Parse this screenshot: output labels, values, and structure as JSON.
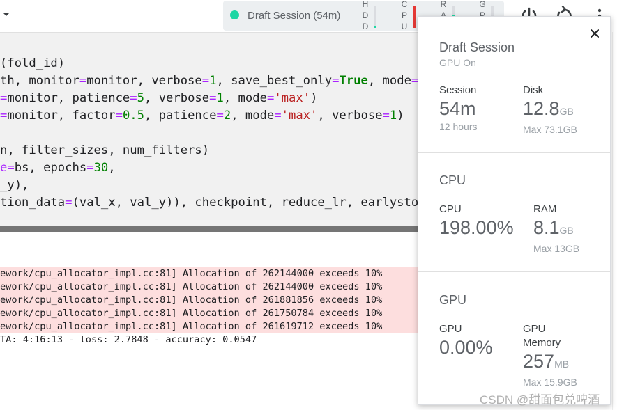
{
  "toolbar": {
    "session_label": "Draft Session (54m)",
    "meters": [
      {
        "label": "HDD",
        "level": 0.1,
        "status_color": "#1ed6a4"
      },
      {
        "label": "CPU",
        "level": 1.0,
        "status_color": "#e53935"
      },
      {
        "label": "RAM",
        "level": 0.6,
        "status_color": "#1ed6a4"
      },
      {
        "label": "GPU",
        "level": 0.0,
        "status_color": "#1ed6a4"
      }
    ],
    "icons": [
      "power-icon",
      "restart-icon",
      "more-vert-icon"
    ]
  },
  "code": {
    "lines": [
      [
        {
          "t": "(fold_id)"
        }
      ],
      [
        {
          "t": "th, monitor"
        },
        {
          "t": "=",
          "c": "op"
        },
        {
          "t": "monitor, verbose"
        },
        {
          "t": "=",
          "c": "op"
        },
        {
          "t": "1",
          "c": "num"
        },
        {
          "t": ", save_best_only"
        },
        {
          "t": "=",
          "c": "op"
        },
        {
          "t": "True",
          "c": "kw"
        },
        {
          "t": ", mode"
        },
        {
          "t": "=",
          "c": "op"
        }
      ],
      [
        {
          "t": "=",
          "c": "op"
        },
        {
          "t": "monitor, patience"
        },
        {
          "t": "=",
          "c": "op"
        },
        {
          "t": "5",
          "c": "num"
        },
        {
          "t": ", verbose"
        },
        {
          "t": "=",
          "c": "op"
        },
        {
          "t": "1",
          "c": "num"
        },
        {
          "t": ", mode"
        },
        {
          "t": "=",
          "c": "op"
        },
        {
          "t": "'max'",
          "c": "str"
        },
        {
          "t": ")"
        }
      ],
      [
        {
          "t": "=",
          "c": "op"
        },
        {
          "t": "monitor, factor"
        },
        {
          "t": "=",
          "c": "op"
        },
        {
          "t": "0.5",
          "c": "num"
        },
        {
          "t": ", patience"
        },
        {
          "t": "=",
          "c": "op"
        },
        {
          "t": "2",
          "c": "num"
        },
        {
          "t": ", mode"
        },
        {
          "t": "=",
          "c": "op"
        },
        {
          "t": "'max'",
          "c": "str"
        },
        {
          "t": ", verbose"
        },
        {
          "t": "=",
          "c": "op"
        },
        {
          "t": "1",
          "c": "num"
        },
        {
          "t": ")"
        }
      ],
      [],
      [
        {
          "t": "n, filter_sizes, num_filters)"
        }
      ],
      [
        {
          "t": "e",
          "c": "op"
        },
        {
          "t": "=",
          "c": "op"
        },
        {
          "t": "bs, epochs"
        },
        {
          "t": "=",
          "c": "op"
        },
        {
          "t": "30",
          "c": "num"
        },
        {
          "t": ","
        }
      ],
      [
        {
          "t": "_y),"
        }
      ],
      [
        {
          "t": "tion_data"
        },
        {
          "t": "=",
          "c": "op"
        },
        {
          "t": "(val_x, val_y)), checkpoint, reduce_lr, earlysto"
        }
      ]
    ]
  },
  "output": {
    "lines": [
      {
        "text": "ework/cpu_allocator_impl.cc:81] Allocation of 262144000 exceeds 10%",
        "warn": true
      },
      {
        "text": "ework/cpu_allocator_impl.cc:81] Allocation of 262144000 exceeds 10%",
        "warn": true
      },
      {
        "text": "ework/cpu_allocator_impl.cc:81] Allocation of 261881856 exceeds 10%",
        "warn": true
      },
      {
        "text": "ework/cpu_allocator_impl.cc:81] Allocation of 261750784 exceeds 10%",
        "warn": true
      },
      {
        "text": "ework/cpu_allocator_impl.cc:81] Allocation of 261619712 exceeds 10%",
        "warn": true
      },
      {
        "text": "TA: 4:16:13 - loss: 2.7848 - accuracy: 0.0547",
        "warn": false
      }
    ]
  },
  "panel": {
    "title": "Draft Session",
    "subtitle": "GPU On",
    "session": {
      "label": "Session",
      "value": "54m",
      "sub": "12 hours"
    },
    "disk": {
      "label": "Disk",
      "value": "12.8",
      "unit": "GB",
      "sub": "Max 73.1GB"
    },
    "cpu_section": "CPU",
    "cpu": {
      "label": "CPU",
      "value": "198.00%"
    },
    "ram": {
      "label": "RAM",
      "value": "8.1",
      "unit": "GB",
      "sub": "Max 13GB"
    },
    "gpu_section": "GPU",
    "gpu": {
      "label": "GPU",
      "value": "0.00%"
    },
    "gpu_memory": {
      "label_line1": "GPU",
      "label_line2": "Memory",
      "value": "257",
      "unit": "MB",
      "sub": "Max 15.9GB"
    }
  },
  "watermark": "CSDN @甜面包兑啤酒",
  "colors": {
    "accent": "#1ed6a4",
    "warning_bg": "#fddede",
    "alert": "#e53935"
  }
}
